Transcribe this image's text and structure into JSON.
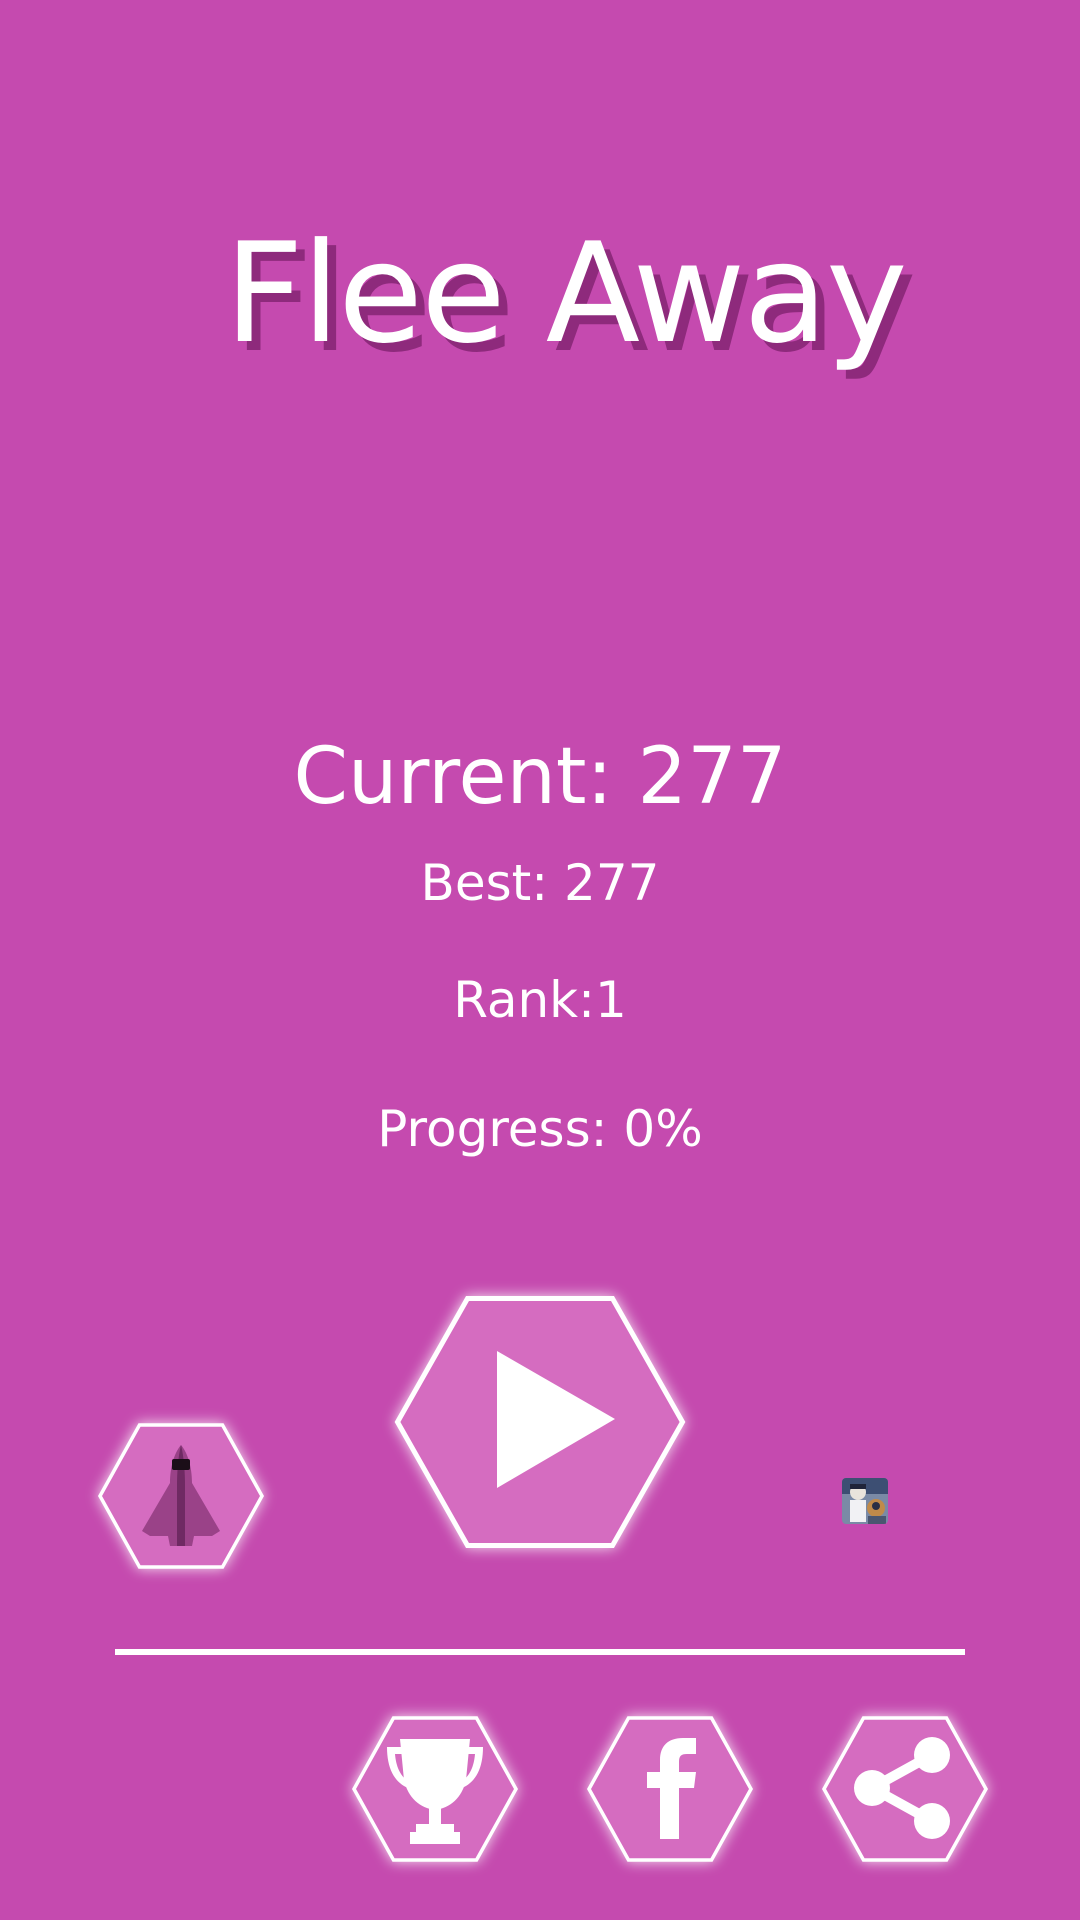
{
  "game": {
    "title": "Flee Away"
  },
  "scores": {
    "current": "Current: 277",
    "best": "Best: 277",
    "rank": "Rank:1",
    "progress": "Progress: 0%"
  },
  "icons": {
    "ship": "rocket-ship-icon",
    "play": "play-icon",
    "leaderboard": "trophy-icon",
    "facebook": "facebook-icon",
    "share": "share-icon",
    "ad": "ad-thumbnail"
  },
  "colors": {
    "background": "#c54aaf",
    "button_fill": "#d56cc0",
    "outline": "#ffffff",
    "title_shadow": "#8e2a7c"
  }
}
